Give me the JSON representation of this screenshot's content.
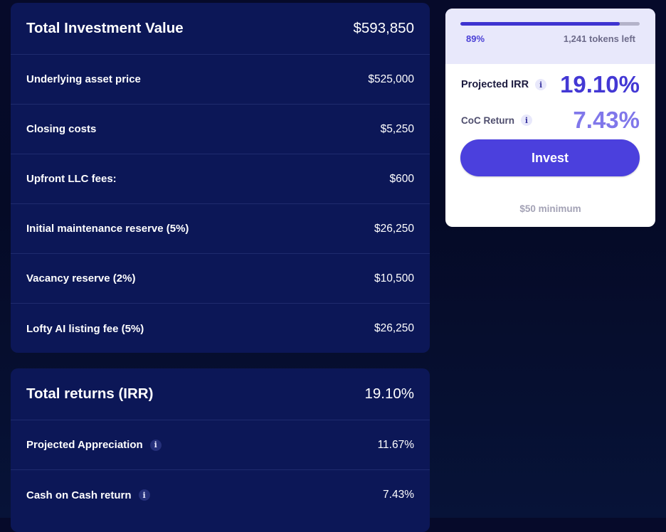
{
  "investment": {
    "header": {
      "label": "Total Investment Value",
      "value": "$593,850"
    },
    "rows": [
      {
        "label": "Underlying asset price",
        "value": "$525,000"
      },
      {
        "label": "Closing costs",
        "value": "$5,250"
      },
      {
        "label": "Upfront LLC fees:",
        "value": "$600"
      },
      {
        "label": "Initial maintenance reserve (5%)",
        "value": "$26,250"
      },
      {
        "label": "Vacancy reserve (2%)",
        "value": "$10,500"
      },
      {
        "label": "Lofty AI listing fee (5%)",
        "value": "$26,250"
      }
    ]
  },
  "returns": {
    "header": {
      "label": "Total returns (IRR)",
      "value": "19.10%"
    },
    "rows": [
      {
        "label": "Projected Appreciation",
        "value": "11.67%",
        "info_icon": "i"
      },
      {
        "label": "Cash on Cash return",
        "value": "7.43%",
        "info_icon": "i"
      }
    ]
  },
  "card": {
    "progress_fraction": 0.89,
    "progress_label": "89%",
    "tokens_left": "1,241 tokens left",
    "irr_label": "Projected IRR",
    "irr_value": "19.10%",
    "coc_label": "CoC Return",
    "coc_value": "7.43%",
    "info_icon": "i",
    "invest_label": "Invest",
    "minimum": "$50 minimum"
  },
  "colors": {
    "background": "#060a2a",
    "panel": "#0c1757",
    "accent": "#4b40dd",
    "irr_value": "#4338d4",
    "coc_value": "#8077ea"
  },
  "icons": {
    "info": "info-icon"
  }
}
